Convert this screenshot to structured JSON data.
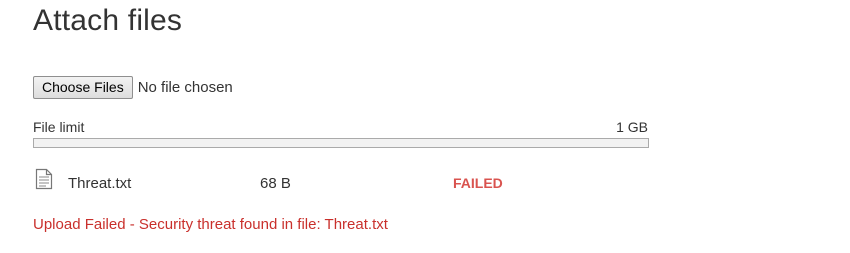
{
  "title": "Attach files",
  "file_input": {
    "button_label": "Choose Files",
    "status_text": "No file chosen"
  },
  "file_limit": {
    "label": "File limit",
    "value": "1 GB",
    "used_fraction": 0
  },
  "files": [
    {
      "icon": "document-icon",
      "name": "Threat.txt",
      "size": "68 B",
      "status": "FAILED"
    }
  ],
  "error_message": "Upload Failed - Security threat found in file: Threat.txt",
  "colors": {
    "error": "#d9534f",
    "error_text": "#c9302c"
  }
}
